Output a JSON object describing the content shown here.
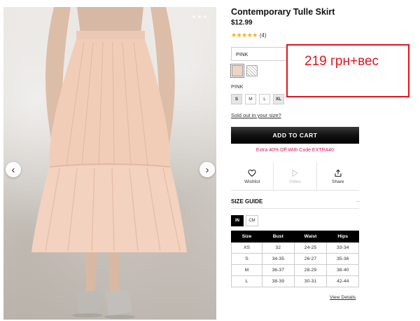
{
  "product": {
    "title": "Contemporary Tulle Skirt",
    "price": "$12.99",
    "stars": "★★★★★",
    "review_count": "(4)",
    "color_select_value": "PINK",
    "color_name": "PINK",
    "sizes": [
      "S",
      "M",
      "L",
      "XL"
    ],
    "sold_out_link": "Sold out in your size?",
    "add_to_cart": "ADD TO CART",
    "promo": "Extra 40% Off With Code EXTRA40"
  },
  "actions": {
    "wishlist": "Wishlist",
    "video": "Video",
    "share": "Share"
  },
  "size_guide": {
    "title": "SIZE GUIDE",
    "collapse_symbol": "-",
    "units": [
      "IN",
      "CM"
    ],
    "columns": [
      "Size",
      "Bust",
      "Waist",
      "Hips"
    ],
    "rows": [
      [
        "XS",
        "32",
        "24-25",
        "33-34"
      ],
      [
        "S",
        "34-35",
        "26-27",
        "35-36"
      ],
      [
        "M",
        "36-37",
        "28-29",
        "38-40"
      ],
      [
        "L",
        "38-39",
        "30-31",
        "42-44"
      ]
    ],
    "view_details": "View Details"
  },
  "annotation": {
    "text": "219 грн+вес",
    "color": "#e0141e"
  },
  "colors": {
    "accent_pink": "#d4145a",
    "star": "#f2b01e",
    "swatch_pink": "#efd4c3"
  }
}
